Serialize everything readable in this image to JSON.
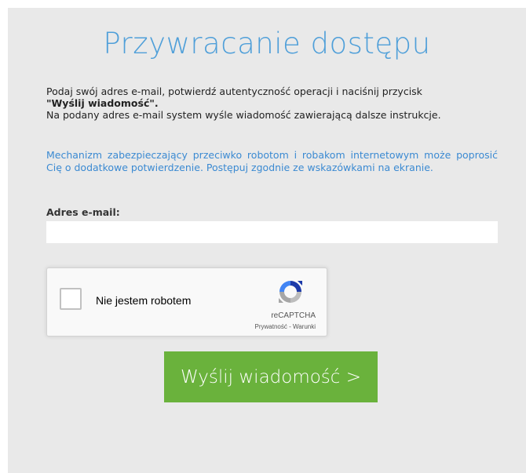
{
  "page": {
    "title": "Przywracanie dostępu"
  },
  "instructions": {
    "line1": "Podaj swój adres e-mail, potwierdź autentyczność operacji i naciśnij przycisk",
    "button_ref": "\"Wyślij wiadomość\".",
    "line2": "Na podany adres e-mail system wyśle wiadomość zawierającą dalsze instrukcje."
  },
  "notice": {
    "text": "Mechanizm zabezpieczający przeciwko robotom i robakom internetowym może poprosić Cię o dodatkowe potwierdzenie. Postępuj zgodnie ze wskazówkami na ekranie."
  },
  "form": {
    "email_label": "Adres e-mail:",
    "email_value": ""
  },
  "captcha": {
    "label": "Nie jestem robotem",
    "brand": "reCAPTCHA",
    "links": "Prywatność - Warunki",
    "icon": "recaptcha-logo-icon"
  },
  "submit": {
    "label": "Wyślij wiadomość >"
  },
  "colors": {
    "title": "#4f9fd9",
    "notice": "#3b8ad2",
    "button": "#6ab23c",
    "panel": "#e9e9e9"
  }
}
